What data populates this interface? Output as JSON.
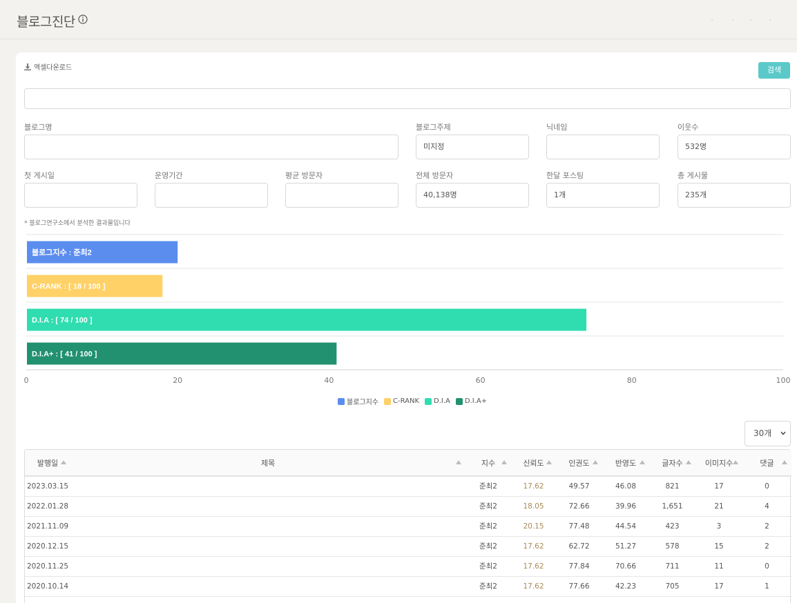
{
  "header": {
    "title": "블로그진단",
    "info_icon": "info-icon"
  },
  "toolbar": {
    "excel_label": "엑셀다운로드",
    "excel_icon": "download-icon",
    "search_label": "검색"
  },
  "fields": {
    "blog_name": {
      "label": "블로그명",
      "value": ""
    },
    "blog_topic": {
      "label": "블로그주제",
      "value": "미지정"
    },
    "nickname": {
      "label": "닉네임",
      "value": ""
    },
    "neighbors": {
      "label": "이웃수",
      "value": "532명"
    },
    "first_post": {
      "label": "첫 게시일",
      "value": ""
    },
    "operation_period": {
      "label": "운영기간",
      "value": ""
    },
    "avg_visitors": {
      "label": "평균 방문자",
      "value": ""
    },
    "total_visitors": {
      "label": "전체 방문자",
      "value": "40,138명"
    },
    "monthly_posts": {
      "label": "한달 포스팅",
      "value": "1개"
    },
    "total_posts": {
      "label": "총 게시물",
      "value": "235개"
    }
  },
  "note": "* 블로그연구소에서 분석한 결과물입니다",
  "chart_data": {
    "type": "bar",
    "orientation": "horizontal",
    "categories": [
      "블로그지수 : 준최2",
      "C-RANK : [ 18 / 100 ]",
      "D.I.A : [ 74 / 100 ]",
      "D.I.A+ : [ 41 / 100 ]"
    ],
    "values": [
      20,
      18,
      74,
      41
    ],
    "colors": [
      "#5b8def",
      "#ffd166",
      "#2fddb0",
      "#21916f"
    ],
    "xlim": [
      0,
      100
    ],
    "xticks": [
      "0",
      "20",
      "40",
      "60",
      "80",
      "100"
    ],
    "legend": [
      "블로그지수",
      "C-RANK",
      "D.I.A",
      "D.I.A+"
    ],
    "legend_position": "bottom",
    "grid": true
  },
  "per_page": "30개",
  "table": {
    "headers": [
      "발행일",
      "제목",
      "지수",
      "신뢰도",
      "인권도",
      "반영도",
      "글자수",
      "이미지수",
      "댓글"
    ],
    "rows": [
      [
        "2023.03.15",
        "",
        "준최2",
        "17.62",
        "49.57",
        "46.08",
        "821",
        "17",
        "0"
      ],
      [
        "2022.01.28",
        "",
        "준최2",
        "18.05",
        "72.66",
        "39.96",
        "1,651",
        "21",
        "4"
      ],
      [
        "2021.11.09",
        "",
        "준최2",
        "20.15",
        "77.48",
        "44.54",
        "423",
        "3",
        "2"
      ],
      [
        "2020.12.15",
        "",
        "준최2",
        "17.62",
        "62.72",
        "51.27",
        "578",
        "15",
        "2"
      ],
      [
        "2020.11.25",
        "",
        "준최2",
        "17.62",
        "77.84",
        "70.66",
        "711",
        "11",
        "0"
      ],
      [
        "2020.10.14",
        "",
        "준최2",
        "17.62",
        "77.66",
        "42.23",
        "705",
        "17",
        "1"
      ],
      [
        "",
        "",
        "",
        "",
        "",
        "",
        "",
        "",
        ""
      ]
    ]
  }
}
